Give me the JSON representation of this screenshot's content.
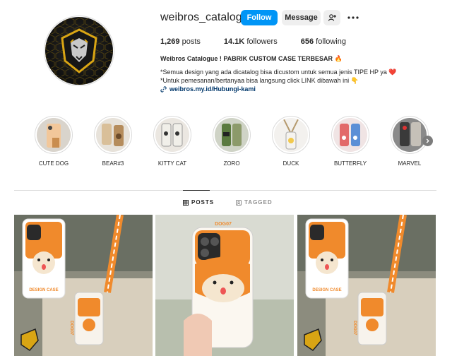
{
  "profile": {
    "username": "weibros_catalog1",
    "follow_label": "Follow",
    "message_label": "Message",
    "stats": {
      "posts": "1,269",
      "posts_label": "posts",
      "followers": "14.1K",
      "followers_label": "followers",
      "following": "656",
      "following_label": "following"
    },
    "bio_name": "Weibros Catalogue ! PABRIK CUSTOM CASE TERBESAR 🔥",
    "bio_line1": "*Semua design yang ada dicatalog bisa dicustom untuk semua jenis TIPE HP ya ❤️",
    "bio_line2": "*Untuk pemesanan/bertanyaa bisa langsung click LINK dibawah ini 👇",
    "link": "weibros.my.id/Hubungi-kami"
  },
  "highlights": [
    {
      "label": "CUTE DOG"
    },
    {
      "label": "BEAR#3"
    },
    {
      "label": "KITTY CAT"
    },
    {
      "label": "ZORO"
    },
    {
      "label": "DUCK"
    },
    {
      "label": "BUTTERFLY"
    },
    {
      "label": "MARVEL"
    }
  ],
  "tabs": {
    "posts": "POSTS",
    "tagged": "TAGGED"
  },
  "posts": [
    {
      "case_text": "DESIGN CASE",
      "tag_text": "DOG07"
    },
    {
      "tag_text": "DOG07"
    },
    {
      "case_text": "DESIGN CASE",
      "tag_text": "DOG07"
    }
  ],
  "icons": [
    "person-add-icon",
    "more-icon",
    "link-icon",
    "chevron-right-icon",
    "grid-icon",
    "tag-icon"
  ],
  "colors": {
    "accent": "#0095f6",
    "case_orange": "#f08a2c"
  }
}
